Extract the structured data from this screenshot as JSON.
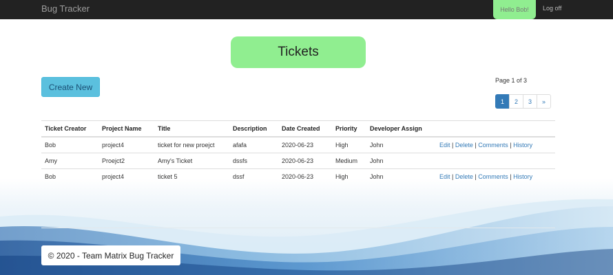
{
  "navbar": {
    "brand": "Bug Tracker",
    "greeting": "Hello Bob!",
    "logoff": "Log off"
  },
  "page": {
    "title": "Tickets",
    "create_new": "Create New",
    "page_info": "Page 1 of 3"
  },
  "pagination": {
    "pages": [
      "1",
      "2",
      "3"
    ],
    "next": "»",
    "active": "1"
  },
  "table": {
    "headers": [
      "Ticket Creator",
      "Project Name",
      "Title",
      "Description",
      "Date Created",
      "Priority",
      "Developer Assign"
    ],
    "rows": [
      {
        "creator": "Bob",
        "project": "project4",
        "title": "ticket for new proejct",
        "description": "afafa",
        "date": "2020-06-23",
        "priority": "High",
        "developer": "John",
        "has_actions": true
      },
      {
        "creator": "Amy",
        "project": "Proejct2",
        "title": "Amy's Ticket",
        "description": "dssfs",
        "date": "2020-06-23",
        "priority": "Medium",
        "developer": "John",
        "has_actions": false
      },
      {
        "creator": "Bob",
        "project": "project4",
        "title": "ticket 5",
        "description": "dssf",
        "date": "2020-06-23",
        "priority": "High",
        "developer": "John",
        "has_actions": true
      }
    ],
    "actions": {
      "edit": "Edit",
      "delete": "Delete",
      "comments": "Comments",
      "history": "History",
      "separator": "|"
    }
  },
  "footer": {
    "text": "© 2020 - Team Matrix Bug Tracker"
  },
  "colors": {
    "navbar": "#222222",
    "accent_green": "#90ee90",
    "create_button": "#5bc0de",
    "link": "#337ab7",
    "active_page": "#337ab7"
  }
}
